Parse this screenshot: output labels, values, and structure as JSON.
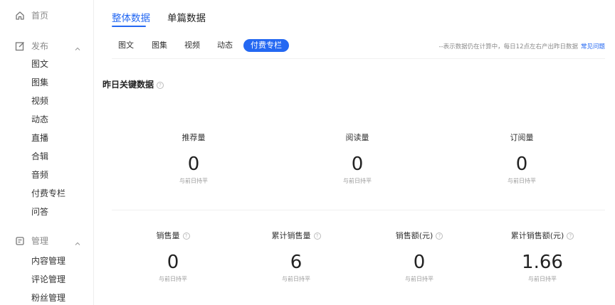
{
  "sidebar": {
    "home": {
      "label": "首页",
      "icon": "home-icon"
    },
    "publish": {
      "label": "发布",
      "icon": "edit-icon",
      "items": [
        "图文",
        "图集",
        "视频",
        "动态",
        "直播",
        "合辑",
        "音频",
        "付费专栏",
        "问答"
      ]
    },
    "manage": {
      "label": "管理",
      "icon": "manage-icon",
      "items": [
        "内容管理",
        "评论管理",
        "粉丝管理"
      ]
    }
  },
  "top_tabs": [
    "整体数据",
    "单篇数据"
  ],
  "sub_tabs": [
    "图文",
    "图集",
    "视频",
    "动态",
    "付费专栏"
  ],
  "notice": {
    "text": "--表示数据仍在计算中，每日12点左右产出昨日数据",
    "link": "常见问题"
  },
  "section": {
    "title": "昨日关键数据",
    "help": "?"
  },
  "metrics_row1": [
    {
      "label": "推荐量",
      "value": "0",
      "sub": "与前日持平"
    },
    {
      "label": "阅读量",
      "value": "0",
      "sub": "与前日持平"
    },
    {
      "label": "订阅量",
      "value": "0",
      "sub": "与前日持平"
    }
  ],
  "metrics_row2": [
    {
      "label": "销售量",
      "value": "0",
      "sub": "与前日持平"
    },
    {
      "label": "累计销售量",
      "value": "6",
      "sub": "与前日持平"
    },
    {
      "label": "销售额(元)",
      "value": "0",
      "sub": "与前日持平"
    },
    {
      "label": "累计销售额(元)",
      "value": "1.66",
      "sub": "与前日持平"
    }
  ],
  "colors": {
    "accent": "#2468f2",
    "muted": "#8a8a8a"
  }
}
